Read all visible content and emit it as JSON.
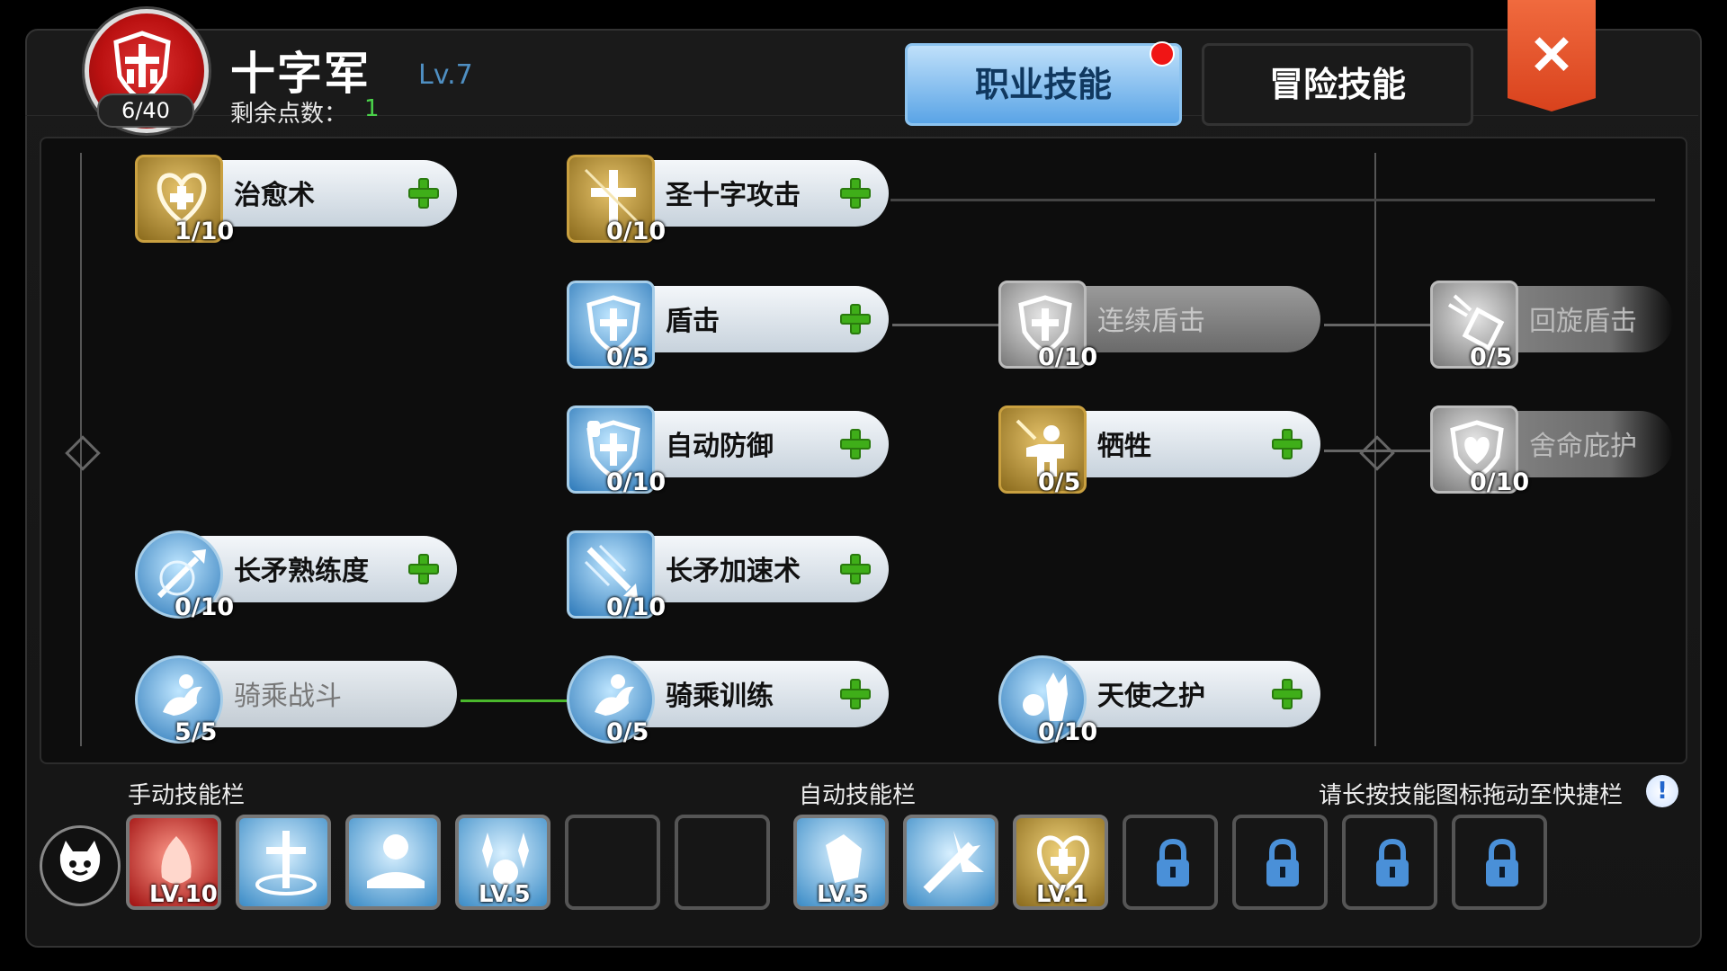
{
  "header": {
    "class_name": "十字军",
    "class_level": "Lv.7",
    "emblem_count": "6/40",
    "points_label": "剩余点数：",
    "points_value": "1"
  },
  "tabs": {
    "job": "职业技能",
    "adventure": "冒险技能"
  },
  "close_label": "✕",
  "skills": {
    "heal": {
      "name": "治愈术",
      "level": "1/10"
    },
    "holy_cross": {
      "name": "圣十字攻击",
      "level": "0/10"
    },
    "shield_bash": {
      "name": "盾击",
      "level": "0/5"
    },
    "combo_shield": {
      "name": "连续盾击",
      "level": "0/10"
    },
    "spin_shield": {
      "name": "回旋盾击",
      "level": "0/5"
    },
    "auto_guard": {
      "name": "自动防御",
      "level": "0/10"
    },
    "sacrifice": {
      "name": "牺牲",
      "level": "0/5"
    },
    "devotion": {
      "name": "舍命庇护",
      "level": "0/10"
    },
    "spear_mastery": {
      "name": "长矛熟练度",
      "level": "0/10"
    },
    "spear_quicken": {
      "name": "长矛加速术",
      "level": "0/10"
    },
    "cavalry_combat": {
      "name": "骑乘战斗",
      "level": "5/5"
    },
    "cavalry_training": {
      "name": "骑乘训练",
      "level": "0/5"
    },
    "angel_protect": {
      "name": "天使之护",
      "level": "0/10"
    }
  },
  "bottom": {
    "manual_label": "手动技能栏",
    "auto_label": "自动技能栏",
    "hint": "请长按技能图标拖动至快捷栏",
    "info": "!",
    "manual_slots": [
      "LV.10",
      "",
      "",
      "LV.5",
      "",
      ""
    ],
    "auto_slots": [
      "LV.5",
      "",
      "LV.1"
    ]
  },
  "colors": {
    "accent_blue": "#5aa4e6",
    "close_orange": "#e5502a",
    "points_green": "#4ad24a",
    "level_blue": "#4f8fc2"
  }
}
